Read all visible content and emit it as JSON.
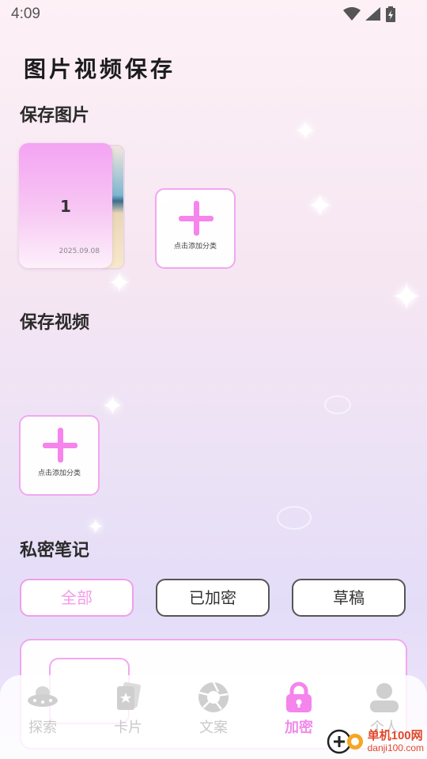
{
  "status_bar": {
    "time": "4:09"
  },
  "app": {
    "title": "图片视频保存"
  },
  "photos": {
    "section_title": "保存图片",
    "albums": [
      {
        "count": "1",
        "date": "2025.09.08"
      }
    ],
    "add_label": "点击添加分类"
  },
  "videos": {
    "section_title": "保存视频",
    "add_label": "点击添加分类"
  },
  "notes": {
    "section_title": "私密笔记",
    "filters": [
      "全部",
      "已加密",
      "草稿"
    ],
    "active_filter": "全部"
  },
  "bottom_nav": {
    "items": [
      {
        "label": "探索",
        "icon": "ufo-icon"
      },
      {
        "label": "卡片",
        "icon": "cards-icon"
      },
      {
        "label": "文案",
        "icon": "aperture-icon"
      },
      {
        "label": "加密",
        "icon": "lock-icon"
      },
      {
        "label": "个人",
        "icon": "person-icon"
      }
    ],
    "active": "加密"
  },
  "watermark": {
    "name": "单机100网",
    "url": "danji100.com"
  },
  "colors": {
    "accent": "#f584ec",
    "accent_border": "#f2a7ef",
    "inactive": "#c9c9c9"
  }
}
